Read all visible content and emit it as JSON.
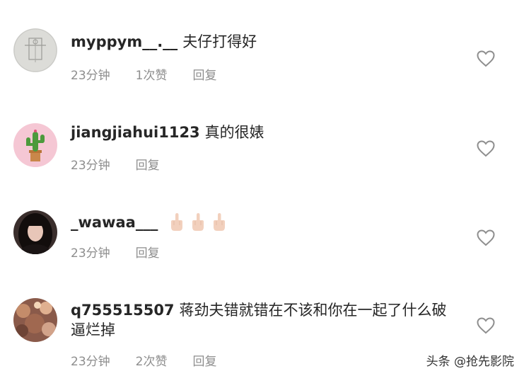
{
  "comments": [
    {
      "username": "myppym__.__",
      "text": "夫仔打得好",
      "time": "23分钟",
      "likes": "1次赞",
      "reply": "回复"
    },
    {
      "username": "jiangjiahui1123",
      "text": "真的很婊",
      "time": "23分钟",
      "reply": "回复"
    },
    {
      "username": "_wawaa___",
      "text": "",
      "emoji": "middle-finger-emoji x3",
      "time": "23分钟",
      "reply": "回复"
    },
    {
      "username": "q755515507",
      "text": "蒋劲夫错就错在不该和你在一起了什么破逼烂掉",
      "time": "23分钟",
      "likes": "2次赞",
      "reply": "回复"
    }
  ],
  "watermark": "头条 @抢先影院",
  "colors": {
    "text": "#262626",
    "meta": "#8e8e8e",
    "heart": "#8e8e8e"
  },
  "icons": {
    "like": "heart-outline-icon"
  }
}
